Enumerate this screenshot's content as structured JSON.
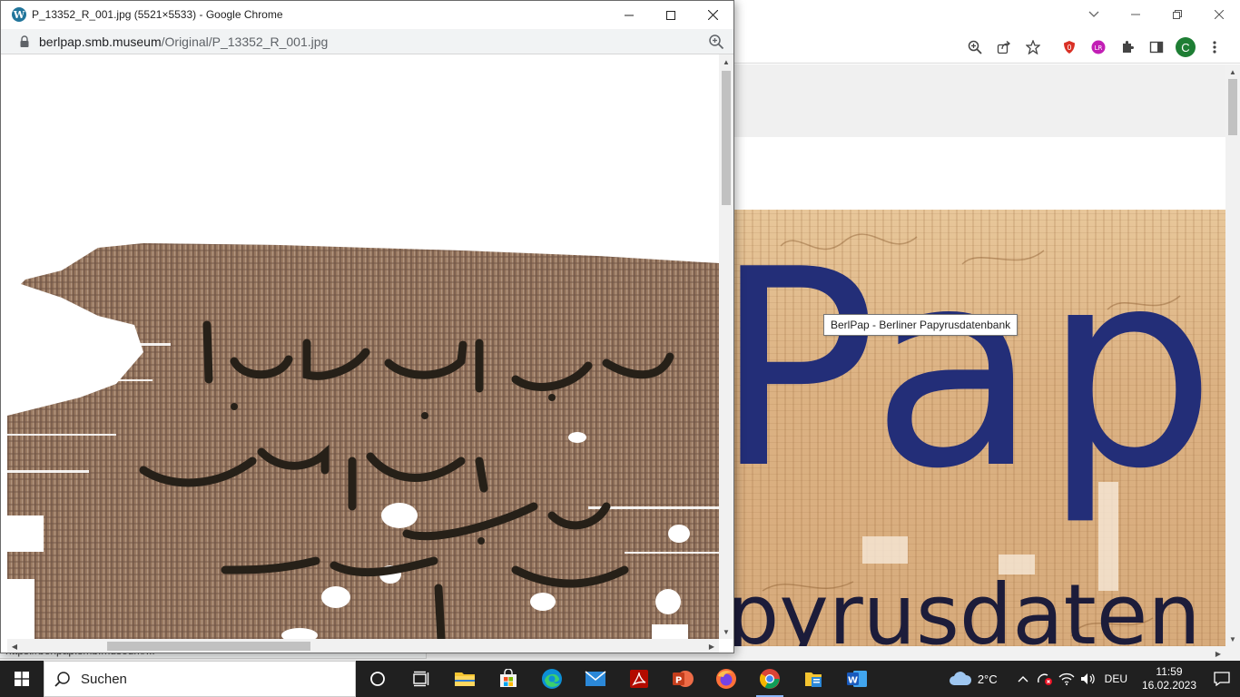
{
  "popup": {
    "title": "P_13352_R_001.jpg (5521×5533) - Google Chrome",
    "url_host": "berlpap.smb.museum",
    "url_path": "/Original/P_13352_R_001.jpg"
  },
  "background_page": {
    "banner_text": "Pap",
    "banner_subtext": "pyrusdaten",
    "tooltip": "BerlPap - Berliner Papyrusdatenbank",
    "status_url": "https://berlpap.smb.museum/..."
  },
  "taskbar": {
    "search_placeholder": "Suchen",
    "weather_temp": "2°C",
    "language": "DEU",
    "time": "11:59",
    "date": "16.02.2023"
  },
  "profile_initial": "C",
  "colors": {
    "banner_text": "#232e78",
    "taskbar_bg": "#202020",
    "profile_green": "#1e7e34",
    "chrome_blue": "#1a73e8"
  }
}
